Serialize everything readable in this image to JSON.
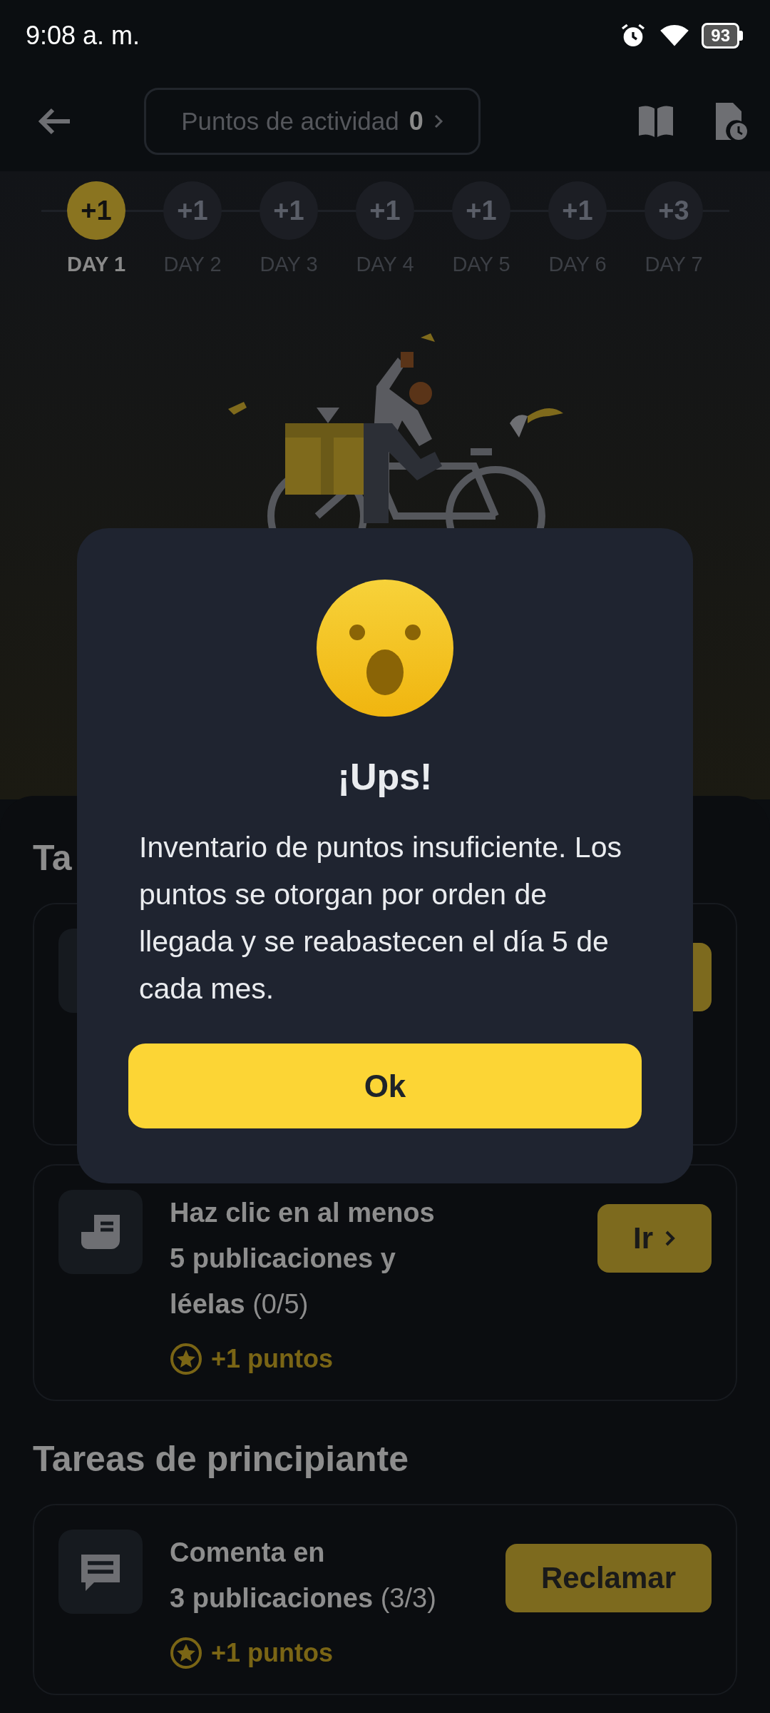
{
  "status_bar": {
    "time": "9:08 a. m.",
    "battery": "93"
  },
  "top_bar": {
    "points_label": "Puntos de actividad",
    "points_value": "0"
  },
  "days": [
    {
      "reward": "+1",
      "label": "DAY 1",
      "selected": true
    },
    {
      "reward": "+1",
      "label": "DAY 2",
      "selected": false
    },
    {
      "reward": "+1",
      "label": "DAY 3",
      "selected": false
    },
    {
      "reward": "+1",
      "label": "DAY 4",
      "selected": false
    },
    {
      "reward": "+1",
      "label": "DAY 5",
      "selected": false
    },
    {
      "reward": "+1",
      "label": "DAY 6",
      "selected": false
    },
    {
      "reward": "+3",
      "label": "DAY 7",
      "selected": false
    }
  ],
  "sections": [
    {
      "title": "Ta",
      "tasks": [
        {
          "kind": "covered"
        },
        {
          "kind": "reading",
          "title": "Haz clic en al menos\n5 publicaciones y\nléelas",
          "progress": "(0/5)",
          "points": "+1 puntos",
          "button": "Ir",
          "button_chevron": true
        }
      ]
    },
    {
      "title": "Tareas de principiante",
      "tasks": [
        {
          "kind": "commenting",
          "title": "Comenta en\n3 publicaciones",
          "progress": "(3/3)",
          "points": "+1 puntos",
          "button": "Reclamar",
          "button_chevron": false
        }
      ]
    }
  ],
  "dialog": {
    "title": "¡Ups!",
    "message": "Inventario de puntos insuficiente. Los puntos se otorgan por orden de llegada y se reabastecen el día 5 de cada mes.",
    "button": "Ok"
  }
}
